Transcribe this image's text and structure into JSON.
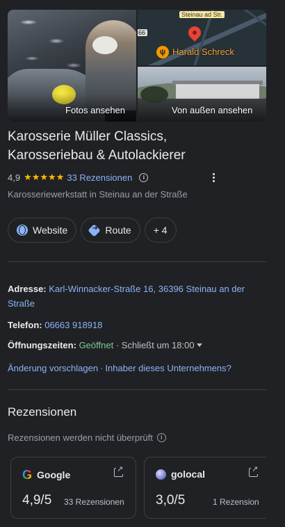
{
  "photos": {
    "photos_label": "Fotos ansehen",
    "map_town_label": "Steinau ad Str.",
    "map_road_shield": "66",
    "map_poi_name": "Harald Schreck",
    "exterior_label": "Von außen ansehen"
  },
  "business": {
    "name": "Karosserie Müller Classics, Karosseriebau & Autolackierer",
    "rating": "4,9",
    "stars": "★★★★★",
    "reviews_link": "33 Rezensionen",
    "category": "Karosseriewerkstatt in Steinau an der Straße"
  },
  "actions": {
    "website": "Website",
    "route": "Route",
    "more": "+ 4"
  },
  "details": {
    "address_label": "Adresse:",
    "address_value": "Karl-Winnacker-Straße 16, 36396 Steinau an der Straße",
    "phone_label": "Telefon:",
    "phone_value": "06663 918918",
    "hours_label": "Öffnungszeiten:",
    "hours_status": "Geöffnet",
    "hours_closes": "· Schließt um 18:00"
  },
  "suggest": {
    "edit": "Änderung vorschlagen",
    "separator": "·",
    "owner": "Inhaber dieses Unternehmens?"
  },
  "reviews": {
    "title": "Rezensionen",
    "note": "Rezensionen werden nicht überprüft",
    "sources": [
      {
        "name": "Google",
        "logo": "G",
        "score": "4,9/5",
        "count": "33 Rezensionen"
      },
      {
        "name": "golocal",
        "score": "3,0/5",
        "count": "1 Rezension"
      }
    ]
  },
  "colors": {
    "background": "#202124",
    "link": "#8ab4f8",
    "open": "#81c995",
    "star": "#fbbc04"
  }
}
